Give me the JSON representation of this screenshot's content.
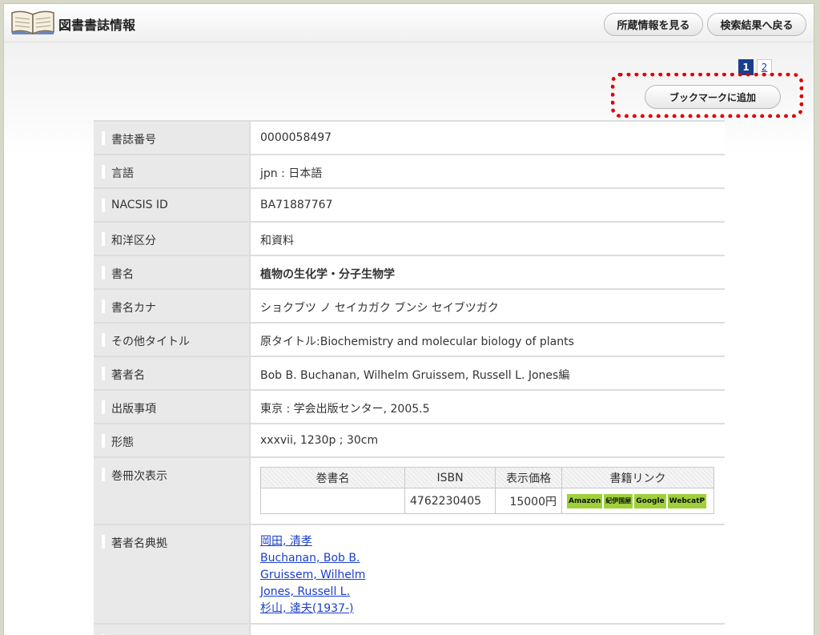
{
  "header": {
    "title": "図書書誌情報",
    "holdings_button": "所蔵情報を見る",
    "back_button": "検索結果へ戻る"
  },
  "pager": {
    "pages": [
      "1",
      "2"
    ],
    "current": "1"
  },
  "bookmark_button": "ブックマークに追加",
  "fields": [
    {
      "label": "書誌番号",
      "value": "0000058497"
    },
    {
      "label": "言語",
      "value": "jpn : 日本語"
    },
    {
      "label": "NACSIS ID",
      "value": "BA71887767"
    },
    {
      "label": "和洋区分",
      "value": "和資料"
    },
    {
      "label": "書名",
      "value": "植物の生化学・分子生物学"
    },
    {
      "label": "書名カナ",
      "value": "ショクブツ ノ セイカガク ブンシ セイブツガク"
    },
    {
      "label": "その他タイトル",
      "value": "原タイトル:Biochemistry and molecular biology of plants"
    },
    {
      "label": "著者名",
      "value": "Bob B. Buchanan, Wilhelm Gruissem, Russell L. Jones編"
    },
    {
      "label": "出版事項",
      "value": "東京 : 学会出版センター, 2005.5"
    },
    {
      "label": "形態",
      "value": "xxxvii, 1230p ; 30cm"
    }
  ],
  "volumes": {
    "label": "巻冊次表示",
    "headers": [
      "巻書名",
      "ISBN",
      "表示価格",
      "書籍リンク"
    ],
    "rows": [
      {
        "title": "",
        "isbn": "4762230405",
        "price": "15000円"
      }
    ],
    "links": [
      "Amazon",
      "紀伊国屋",
      "Google",
      "WebcatP"
    ]
  },
  "authorities": {
    "label": "著者名典拠",
    "items": [
      "岡田, 清孝",
      "Buchanan, Bob B.",
      "Gruissem, Wilhelm",
      "Jones, Russell L.",
      "杉山, 達夫(1937-)"
    ]
  }
}
